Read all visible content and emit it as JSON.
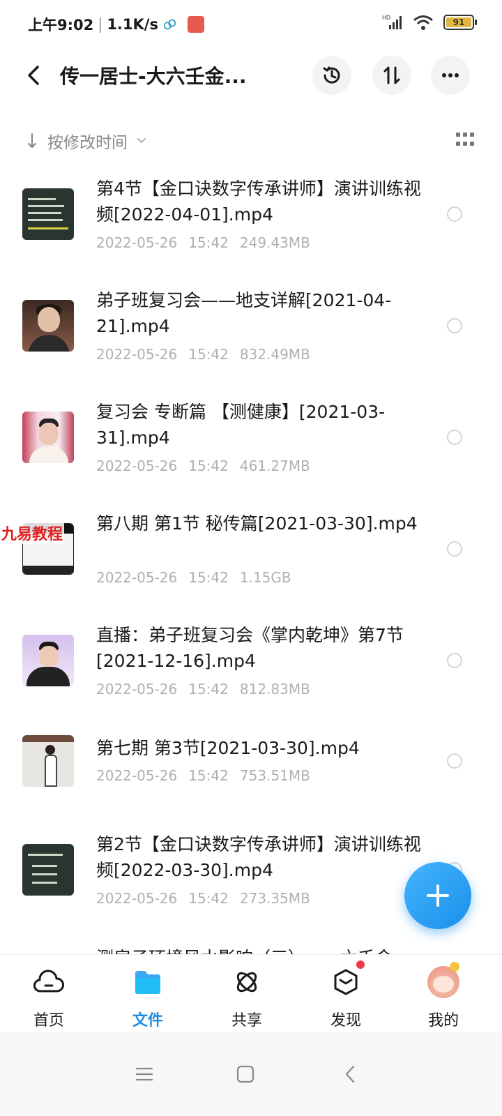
{
  "status_bar": {
    "time": "上午9:02",
    "net_speed": "1.1K/s",
    "battery": "91",
    "signal_label": "HD"
  },
  "header": {
    "title": "传一居士-大六壬金...",
    "icons": [
      "back-arrow-icon",
      "history-icon",
      "sort-icon",
      "more-icon"
    ]
  },
  "sort": {
    "label": "按修改时间"
  },
  "files": [
    {
      "name": "第4节【金口诀数字传承讲师】演讲训练视频[2022-04-01].mp4",
      "date": "2022-05-26",
      "time": "15:42",
      "size": "249.43MB"
    },
    {
      "name": "弟子班复习会——地支详解[2021-04-21].mp4",
      "date": "2022-05-26",
      "time": "15:42",
      "size": "832.49MB"
    },
    {
      "name": "复习会  专断篇 【测健康】[2021-03-31].mp4",
      "date": "2022-05-26",
      "time": "15:42",
      "size": "461.27MB"
    },
    {
      "name": "第八期  第1节  秘传篇[2021-03-30].mp4",
      "date": "2022-05-26",
      "time": "15:42",
      "size": "1.15GB"
    },
    {
      "name": "直播：弟子班复习会《掌内乾坤》第7节[2021-12-16].mp4",
      "date": "2022-05-26",
      "time": "15:42",
      "size": "812.83MB"
    },
    {
      "name": "第七期  第3节[2021-03-30].mp4",
      "date": "2022-05-26",
      "time": "15:42",
      "size": "753.51MB"
    },
    {
      "name": "第2节【金口诀数字传承讲师】演讲训练视频[2022-03-30].mp4",
      "date": "2022-05-26",
      "time": "15:42",
      "size": "273.35MB"
    }
  ],
  "partial_item": "测房子环境风水影响（三）——六壬金",
  "watermark": "九易教程",
  "nav": {
    "home": "首页",
    "files": "文件",
    "share": "共享",
    "discover": "发现",
    "mine": "我的"
  },
  "colors": {
    "accent": "#1b8de6",
    "badge": "#ee3b4b"
  }
}
